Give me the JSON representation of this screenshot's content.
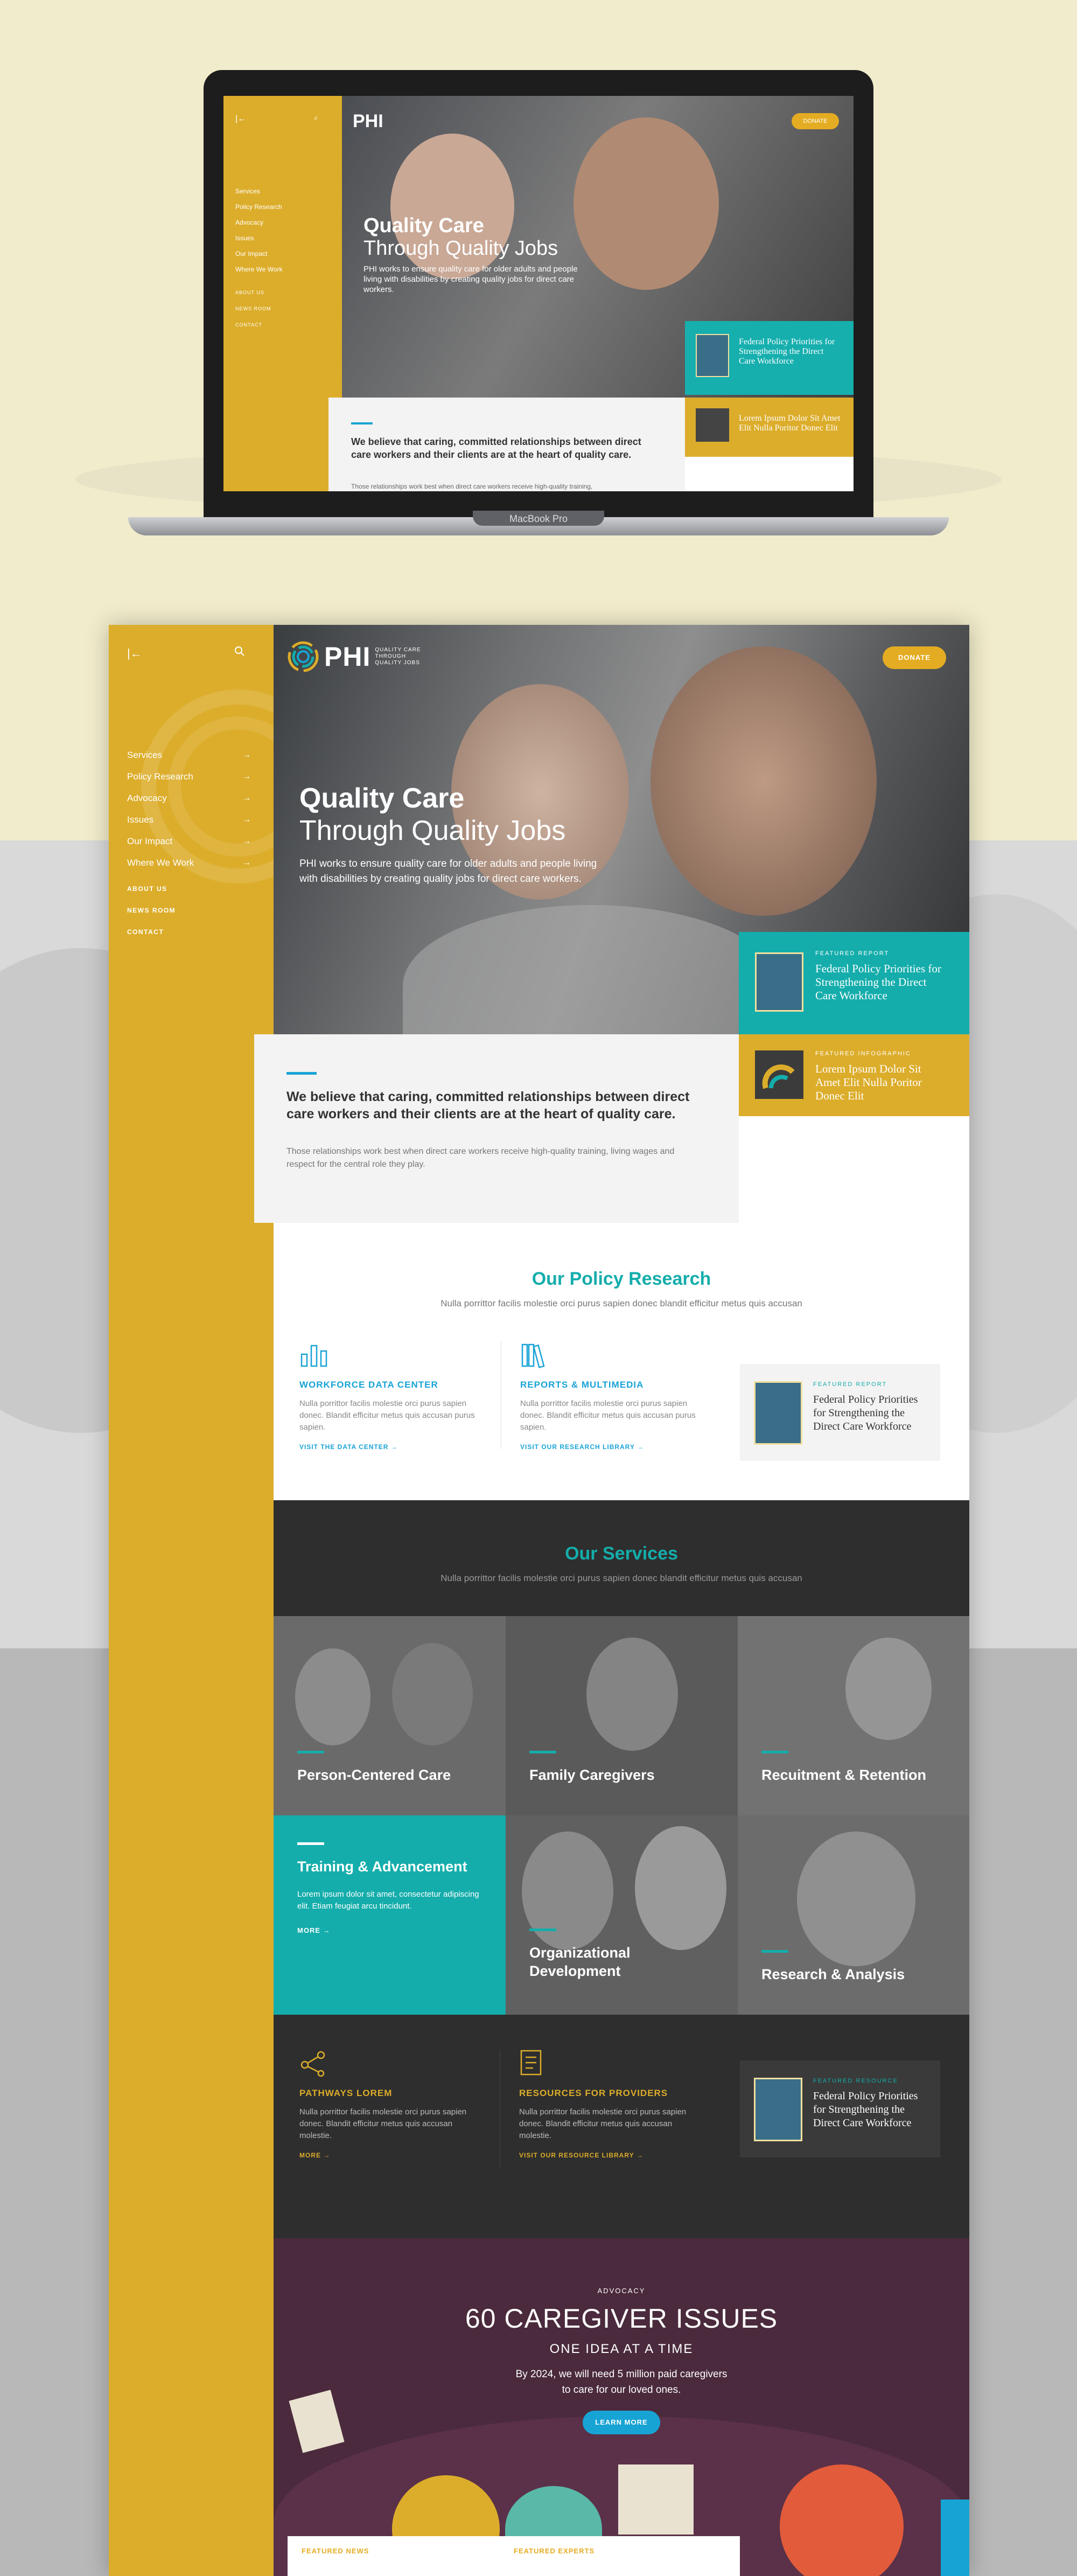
{
  "laptop": {
    "model_label": "MacBook Pro",
    "logo": "PHI",
    "donate": "DONATE",
    "hero_title_bold": "Quality Care",
    "hero_title": "Through Quality Jobs",
    "hero_desc": "PHI works to ensure quality care for older adults and people living with disabilities by creating quality jobs for direct care workers.",
    "nav": [
      "Services",
      "Policy Research",
      "Advocacy",
      "Issues",
      "Our Impact",
      "Where We Work"
    ],
    "subnav": [
      "ABOUT US",
      "NEWS ROOM",
      "CONTACT"
    ],
    "card1_title": "Federal Policy Priorities for Strengthening the Direct Care Workforce",
    "card2_title": "Lorem Ipsum Dolor Sit Amet Elit Nulla Poritor Donec Elit",
    "intro_title": "We believe that caring, committed relationships between direct care workers and their clients are at the heart of quality care.",
    "intro_sub": "Those relationships work best when direct care workers receive high-quality training,"
  },
  "header": {
    "logo_text": "PHI",
    "logo_tagline": "QUALITY CARE THROUGH QUALITY JOBS",
    "donate_label": "DONATE"
  },
  "sidebar": {
    "back_icon": "←",
    "nav": [
      {
        "label": "Services"
      },
      {
        "label": "Policy Research"
      },
      {
        "label": "Advocacy"
      },
      {
        "label": "Issues"
      },
      {
        "label": "Our Impact"
      },
      {
        "label": "Where We Work"
      }
    ],
    "subnav": [
      "ABOUT US",
      "NEWS ROOM",
      "CONTACT"
    ]
  },
  "hero": {
    "title_bold": "Quality Care",
    "title": "Through Quality Jobs",
    "description": "PHI works to ensure quality care for older adults and people living with disabilities by creating quality jobs for direct care workers."
  },
  "featured": {
    "report_eyebrow": "FEATURED REPORT",
    "report_title": "Federal Policy Priorities for Strengthening the Direct Care Workforce",
    "infographic_eyebrow": "FEATURED INFOGRAPHIC",
    "infographic_title": "Lorem Ipsum Dolor Sit Amet Elit Nulla Poritor Donec Elit"
  },
  "intro": {
    "title": "We believe that caring, committed relationships between direct care workers and their clients are at the heart of quality care.",
    "subtitle": "Those relationships work best when direct care workers receive high-quality training, living wages and respect for the central role they play."
  },
  "policy": {
    "title": "Our Policy Research",
    "subtitle": "Nulla porrittor facilis molestie orci purus sapien donec blandit efficitur metus quis accusan",
    "cols": [
      {
        "head": "WORKFORCE DATA CENTER",
        "body": "Nulla porrittor facilis molestie orci purus sapien donec. Blandit efficitur metus quis accusan purus sapien.",
        "link": "VISIT THE DATA CENTER →"
      },
      {
        "head": "REPORTS & MULTIMEDIA",
        "body": "Nulla porrittor facilis molestie orci purus sapien donec. Blandit efficitur metus quis accusan purus sapien.",
        "link": "VISIT OUR RESEARCH LIBRARY →"
      }
    ],
    "card_eyebrow": "FEATURED REPORT",
    "card_title": "Federal Policy Priorities for Strengthening the Direct Care Workforce"
  },
  "services": {
    "title": "Our Services",
    "subtitle": "Nulla porrittor facilis molestie orci purus sapien donec blandit efficitur metus quis accusan",
    "tiles": [
      {
        "label": "Person-Centered Care"
      },
      {
        "label": "Family Caregivers"
      },
      {
        "label": "Recuitment & Retention"
      },
      {
        "label": "Training & Advancement",
        "desc": "Lorem ipsum dolor sit amet, consectetur adipiscing elit. Etiam feugiat arcu tincidunt.",
        "more": "MORE →"
      },
      {
        "label": "Organizational Development"
      },
      {
        "label": "Research & Analysis"
      }
    ],
    "cols": [
      {
        "head": "PATHWAYS LOREM",
        "body": "Nulla porrittor facilis molestie orci purus sapien donec. Blandit efficitur metus quis accusan molestie.",
        "link": "MORE →"
      },
      {
        "head": "RESOURCES FOR PROVIDERS",
        "body": "Nulla porrittor facilis molestie orci purus sapien donec. Blandit efficitur metus quis accusan molestie.",
        "link": "VISIT OUR RESOURCE LIBRARY →"
      }
    ],
    "card_eyebrow": "FEATURED RESOURCE",
    "card_title": "Federal Policy Priorities for Strengthening the Direct Care Workforce"
  },
  "advocacy": {
    "eyebrow": "ADVOCACY",
    "title": "60 CAREGIVER ISSUES",
    "subtitle": "ONE IDEA AT A TIME",
    "body": "By 2024, we will need 5 million paid caregivers to care for our loved ones.",
    "button": "LEARN MORE"
  },
  "footer_tabs": {
    "news": "FEATURED NEWS",
    "experts": "FEATURED EXPERTS"
  },
  "colors": {
    "gold": "#dcad2b",
    "teal": "#14adab",
    "blue": "#18a3d5",
    "dark": "#2e2e2e"
  }
}
